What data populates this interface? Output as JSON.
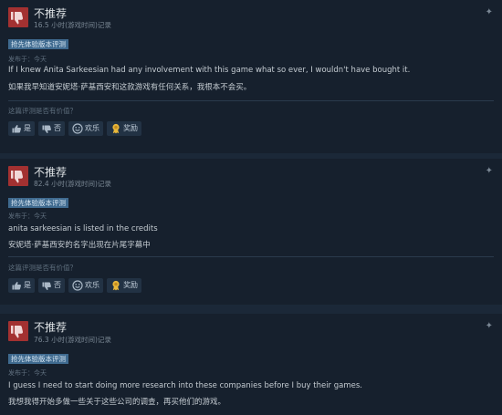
{
  "reviews": [
    {
      "verdict": "不推荐",
      "hours": "16.5 小时(游戏时间)记录",
      "badge": "抢先体验版本评测",
      "posted": "发布于：今天",
      "text_en": "If I knew Anita Sarkeesian had any involvement with this game what so ever, I wouldn't have bought it.",
      "text_zh": "如果我早知道安妮塔·萨基西安和这款游戏有任何关系，我根本不会买。",
      "helpful_prompt": "这篇评测是否有价值？",
      "buttons": {
        "yes": "是",
        "no": "否",
        "funny": "欢乐",
        "award": "奖励"
      }
    },
    {
      "verdict": "不推荐",
      "hours": "82.4 小时(游戏时间)记录",
      "badge": "抢先体验版本评测",
      "posted": "发布于：今天",
      "text_en": "anita sarkeesian is listed in the credits",
      "text_zh": "安妮塔·萨基西安的名字出现在片尾字幕中",
      "helpful_prompt": "这篇评测是否有价值？",
      "buttons": {
        "yes": "是",
        "no": "否",
        "funny": "欢乐",
        "award": "奖励"
      }
    },
    {
      "verdict": "不推荐",
      "hours": "76.3 小时(游戏时间)记录",
      "badge": "抢先体验版本评测",
      "posted": "发布于：今天",
      "text_en": "I guess I need to start doing more research into these companies before I buy their games.",
      "text_zh": "我想我得开始多做一些关于这些公司的调查，再买他们的游戏。"
    }
  ],
  "icons": {
    "thumbs_down": "thumbs-down-icon",
    "thumbs_up": "thumbs-up-icon",
    "smiley": "smiley-icon",
    "award": "award-icon",
    "menu": "star-menu-icon"
  },
  "colors": {
    "background": "#1b2838",
    "card": "#16202d",
    "thumb_red": "#a33131",
    "badge_blue": "#3f6a8f",
    "award_gold": "#e9b83a"
  }
}
